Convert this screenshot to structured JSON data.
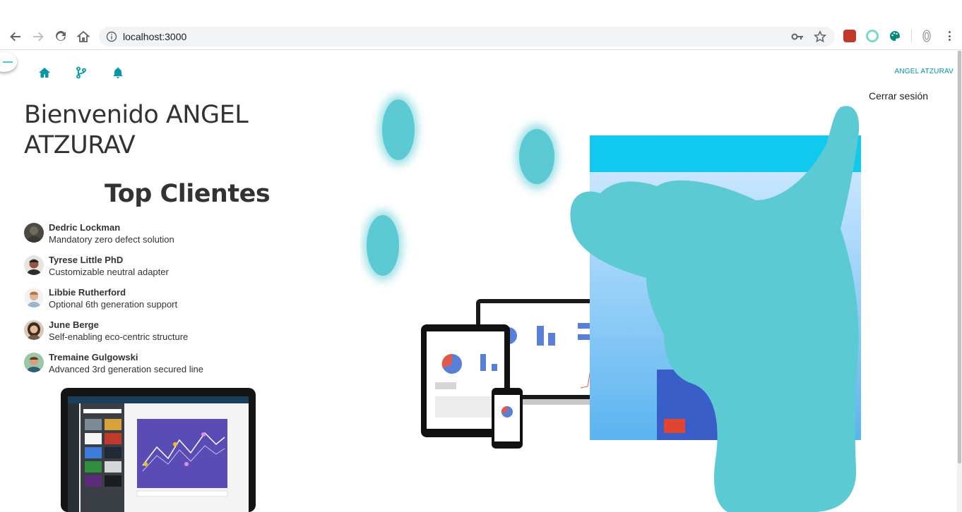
{
  "browser": {
    "url": "localhost:3000"
  },
  "app": {
    "nav_icons": [
      "home-icon",
      "branch-icon",
      "bell-icon"
    ],
    "user_name": "ANGEL ATZURAV",
    "logout_label": "Cerrar sesión",
    "accent_color": "#0097a7"
  },
  "main": {
    "welcome": "Bienvenido ANGEL ATZURAV",
    "top_title": "Top Clientes",
    "clients": [
      {
        "name": "Dedric Lockman",
        "desc": "Mandatory zero defect solution"
      },
      {
        "name": "Tyrese Little PhD",
        "desc": "Customizable neutral adapter"
      },
      {
        "name": "Libbie Rutherford",
        "desc": "Optional 6th generation support"
      },
      {
        "name": "June Berge",
        "desc": "Self-enabling eco-centric structure"
      },
      {
        "name": "Tremaine Gulgowski",
        "desc": "Advanced 3rd generation secured line"
      }
    ]
  }
}
